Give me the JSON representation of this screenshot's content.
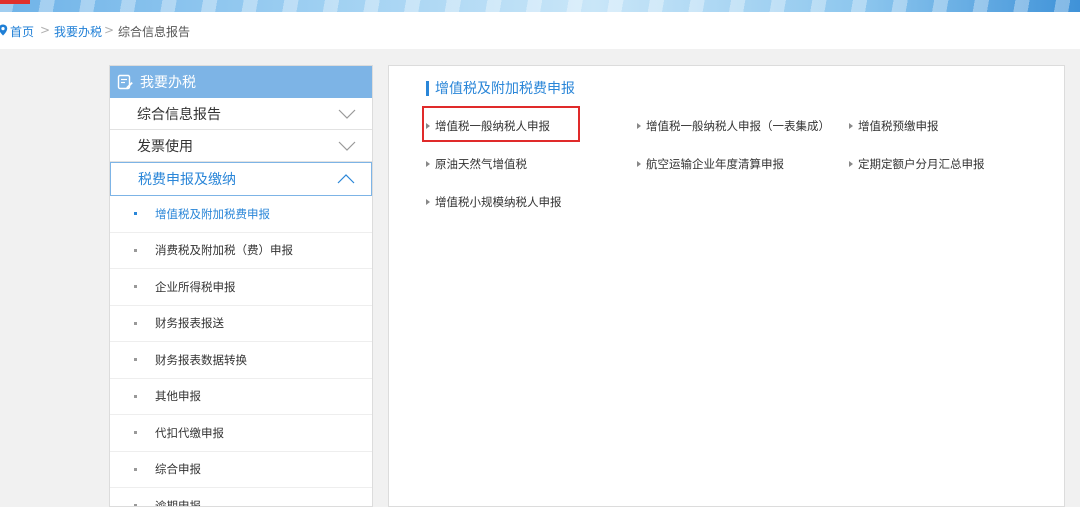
{
  "breadcrumb": {
    "home": "首页",
    "sep1": ">",
    "section": "我要办税",
    "sep2": ">",
    "current": "综合信息报告"
  },
  "sidebar": {
    "title": "我要办税",
    "menus": [
      {
        "label": "综合信息报告",
        "expanded": false
      },
      {
        "label": "发票使用",
        "expanded": false
      },
      {
        "label": "税费申报及缴纳",
        "expanded": true
      }
    ],
    "sub_items": [
      {
        "label": "增值税及附加税费申报",
        "selected": true
      },
      {
        "label": "消费税及附加税（费）申报",
        "selected": false
      },
      {
        "label": "企业所得税申报",
        "selected": false
      },
      {
        "label": "财务报表报送",
        "selected": false
      },
      {
        "label": "财务报表数据转换",
        "selected": false
      },
      {
        "label": "其他申报",
        "selected": false
      },
      {
        "label": "代扣代缴申报",
        "selected": false
      },
      {
        "label": "综合申报",
        "selected": false
      },
      {
        "label": "逾期申报",
        "selected": false
      }
    ]
  },
  "main": {
    "section_title": "增值税及附加税费申报",
    "links": [
      "增值税一般纳税人申报",
      "增值税一般纳税人申报（一表集成）",
      "增值税预缴申报",
      "原油天然气增值税",
      "航空运输企业年度清算申报",
      "定期定额户分月汇总申报",
      "增值税小规模纳税人申报"
    ]
  },
  "colors": {
    "accent": "#2a86d8",
    "sidebar_header": "#7db4e6",
    "highlight": "#e02a2a"
  }
}
